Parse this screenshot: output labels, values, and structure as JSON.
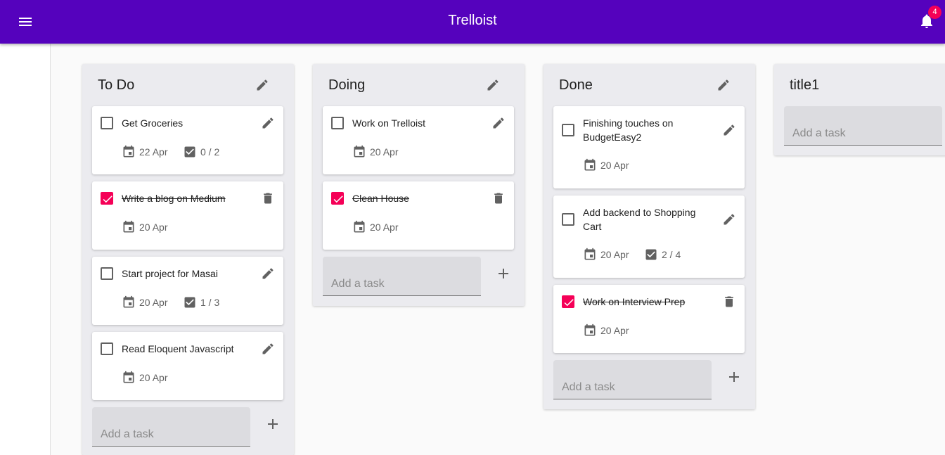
{
  "app": {
    "title": "Trelloist",
    "notifications_count": "4",
    "menu_icon": "menu-icon",
    "bell_icon": "notifications-bell-icon"
  },
  "colors": {
    "appbar": "#5502bd",
    "accent": "#f50057",
    "list_bg": "#ebebef"
  },
  "lists": [
    {
      "title": "To Do",
      "add_placeholder": "Add a task",
      "cards": [
        {
          "text": "Get Groceries",
          "done": false,
          "date": "22 Apr",
          "checklist": "0 / 2"
        },
        {
          "text": "Write a blog on Medium",
          "done": true,
          "date": "20 Apr",
          "checklist": null
        },
        {
          "text": "Start project for Masai",
          "done": false,
          "date": "20 Apr",
          "checklist": "1 / 3"
        },
        {
          "text": "Read Eloquent Javascript",
          "done": false,
          "date": "20 Apr",
          "checklist": null
        }
      ]
    },
    {
      "title": "Doing",
      "add_placeholder": "Add a task",
      "cards": [
        {
          "text": "Work on Trelloist",
          "done": false,
          "date": "20 Apr",
          "checklist": null
        },
        {
          "text": "Clean House",
          "done": true,
          "date": "20 Apr",
          "checklist": null
        }
      ]
    },
    {
      "title": "Done",
      "add_placeholder": "Add a task",
      "cards": [
        {
          "text": "Finishing touches on BudgetEasy2",
          "done": false,
          "date": "20 Apr",
          "checklist": null
        },
        {
          "text": "Add backend to Shopping Cart",
          "done": false,
          "date": "20 Apr",
          "checklist": "2 / 4"
        },
        {
          "text": "Work on Interview Prep",
          "done": true,
          "date": "20 Apr",
          "checklist": null
        }
      ]
    },
    {
      "title": "title1",
      "add_placeholder": "Add a task",
      "cards": []
    }
  ]
}
